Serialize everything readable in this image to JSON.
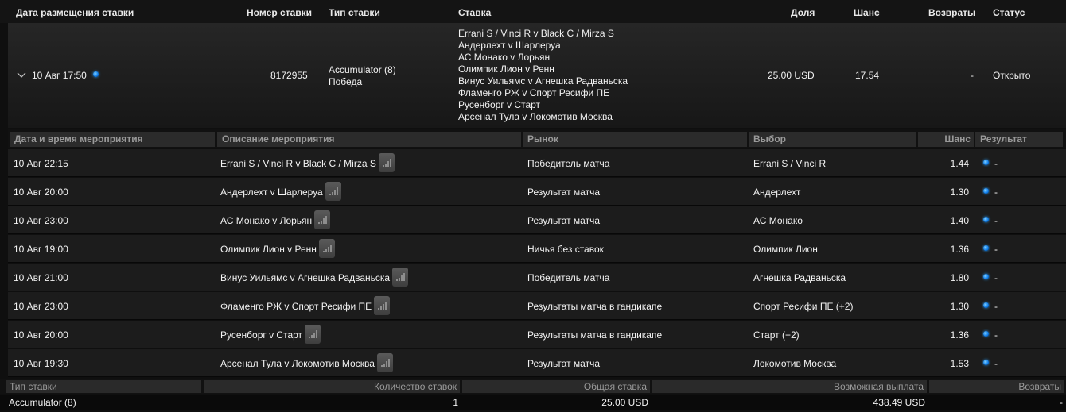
{
  "header": {
    "placed": "Дата размещения ставки",
    "bet_number": "Номер ставки",
    "bet_type": "Тип ставки",
    "bet": "Ставка",
    "stake": "Доля",
    "odds": "Шанс",
    "returns": "Возвраты",
    "status": "Статус"
  },
  "bet": {
    "date": "10 Авг 17:50",
    "number": "8172955",
    "type": "Accumulator (8)",
    "type_sub": "Победа",
    "legs": [
      "Errani S / Vinci R v Black C / Mirza S",
      "Андерлехт v Шарлеруа",
      "АС Монако v Лорьян",
      "Олимпик Лион v Ренн",
      "Винус Уильямс v Агнешка Радваньска",
      "Фламенго РЖ v Спорт Ресифи ПЕ",
      "Русенборг v Старт",
      "Арсенал Тула v Локомотив Москва"
    ],
    "stake": "25.00 USD",
    "odds": "17.54",
    "returns": "-",
    "status": "Открыто"
  },
  "legs_header": {
    "datetime": "Дата и время мероприятия",
    "description": "Описание мероприятия",
    "market": "Рынок",
    "selection": "Выбор",
    "odds": "Шанс",
    "result": "Результат"
  },
  "legs": [
    {
      "date": "10 Авг 22:15",
      "event": "Errani S / Vinci R v Black C / Mirza S",
      "market": "Победитель матча",
      "selection": "Errani S / Vinci R",
      "odds": "1.44",
      "result": "-"
    },
    {
      "date": "10 Авг 20:00",
      "event": "Андерлехт v Шарлеруа",
      "market": "Результат матча",
      "selection": "Андерлехт",
      "odds": "1.30",
      "result": "-"
    },
    {
      "date": "10 Авг 23:00",
      "event": "АС Монако v Лорьян",
      "market": "Результат матча",
      "selection": "АС Монако",
      "odds": "1.40",
      "result": "-"
    },
    {
      "date": "10 Авг 19:00",
      "event": "Олимпик Лион v Ренн",
      "market": "Ничья без ставок",
      "selection": "Олимпик Лион",
      "odds": "1.36",
      "result": "-"
    },
    {
      "date": "10 Авг 21:00",
      "event": "Винус Уильямс v Агнешка Радваньска",
      "market": "Победитель матча",
      "selection": "Агнешка Радваньска",
      "odds": "1.80",
      "result": "-"
    },
    {
      "date": "10 Авг 23:00",
      "event": "Фламенго РЖ v Спорт Ресифи ПЕ",
      "market": "Результаты матча в гандикапе",
      "selection": "Спорт Ресифи ПЕ (+2)",
      "odds": "1.30",
      "result": "-"
    },
    {
      "date": "10 Авг 20:00",
      "event": "Русенборг v Старт",
      "market": "Результаты матча в гандикапе",
      "selection": "Старт (+2)",
      "odds": "1.36",
      "result": "-"
    },
    {
      "date": "10 Авг 19:30",
      "event": "Арсенал Тула v Локомотив Москва",
      "market": "Результат матча",
      "selection": "Локомотив Москва",
      "odds": "1.53",
      "result": "-"
    }
  ],
  "summary_header": {
    "bet_type": "Тип ставки",
    "count": "Количество ставок",
    "total_stake": "Общая ставка",
    "potential_payout": "Возможная выплата",
    "returns": "Возвраты"
  },
  "summary": {
    "bet_type": "Accumulator (8)",
    "count": "1",
    "total_stake": "25.00 USD",
    "potential_payout": "438.49 USD",
    "returns": "-"
  },
  "colors": {
    "status_dot": "#0a78e8",
    "background": "#0f0f0f"
  }
}
